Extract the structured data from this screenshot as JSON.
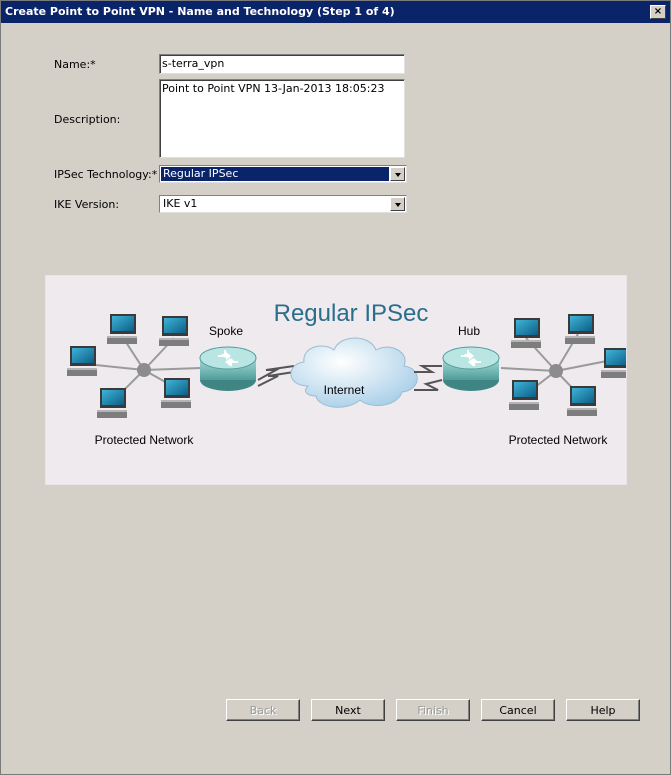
{
  "window": {
    "title": "Create Point to Point VPN - Name and Technology (Step 1 of 4)",
    "close_glyph": "×"
  },
  "form": {
    "name_label": "Name:*",
    "name_value": "s-terra_vpn",
    "description_label": "Description:",
    "description_value": "Point to Point VPN 13-Jan-2013 18:05:23",
    "ipsec_label": "IPSec Technology:*",
    "ipsec_value": "Regular IPSec",
    "ike_label": "IKE Version:",
    "ike_value": "IKE v1"
  },
  "diagram": {
    "title": "Regular IPSec",
    "spoke_label": "Spoke",
    "hub_label": "Hub",
    "internet_label": "Internet",
    "left_network_label": "Protected Network",
    "right_network_label": "Protected Network",
    "colors": {
      "title": "#2a6e8c",
      "router": "#6fb7b6",
      "cloud": "#cfe6f4",
      "monitor": "#1f7fa6"
    }
  },
  "buttons": {
    "back": "Back",
    "next": "Next",
    "finish": "Finish",
    "cancel": "Cancel",
    "help": "Help"
  }
}
